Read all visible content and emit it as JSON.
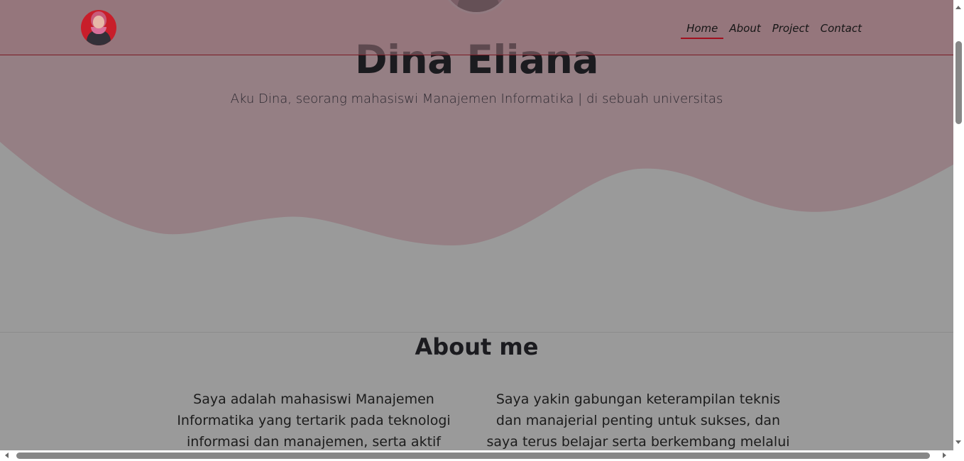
{
  "hero": {
    "title": "Dina Eliana",
    "subtitle": "Aku Dina, seorang mahasiswi Manajemen Informatika | di sebuah universitas",
    "photo_icon": "profile-photo"
  },
  "navbar": {
    "logo_icon": "avatar-logo",
    "links": [
      {
        "label": "Home",
        "active": true
      },
      {
        "label": "About",
        "active": false
      },
      {
        "label": "Project",
        "active": false
      },
      {
        "label": "Contact",
        "active": false
      }
    ]
  },
  "about": {
    "title": "About me",
    "left_text": "Saya adalah mahasiswi Manajemen Informatika yang tertarik pada teknologi informasi dan manajemen, serta aktif menempuh pendidikan",
    "right_text": "Saya yakin gabungan keterampilan teknis dan manajerial penting untuk sukses, dan saya terus belajar serta berkembang melalui berbagai"
  },
  "colors": {
    "hero_pink": "#957f84",
    "page_gray": "#9a9a9a",
    "accent_red": "#a0101e",
    "logo_red": "#c81e2a"
  }
}
